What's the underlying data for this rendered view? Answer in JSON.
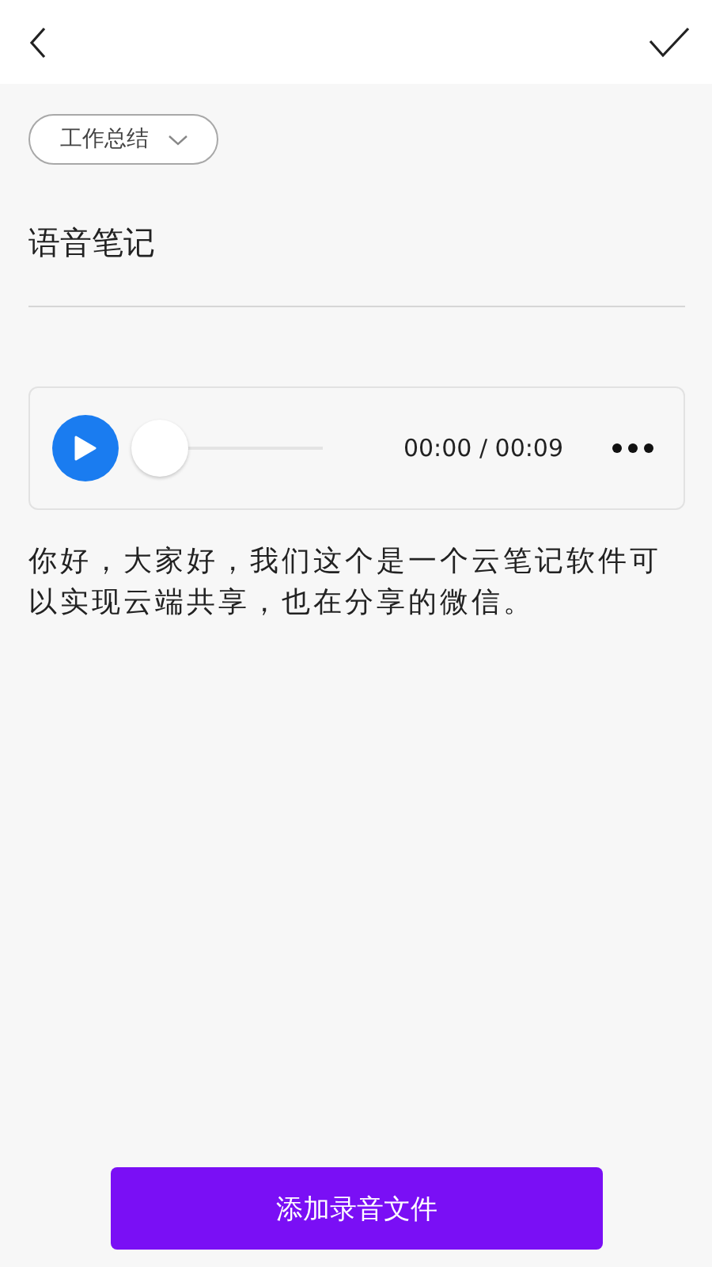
{
  "category": {
    "label": "工作总结"
  },
  "title": "语音笔记",
  "player": {
    "level": 0,
    "time": "00:00 / 00:09"
  },
  "transcript": "你好，大家好，我们这个是一个云笔记软件可以实现云端共享，也在分享的微信。",
  "add_button": "添加录音文件"
}
